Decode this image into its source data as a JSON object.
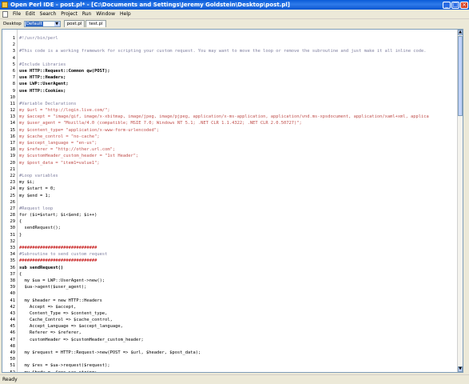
{
  "window": {
    "title": "Open Perl IDE - post.pl* - [C:\\Documents and Settings\\Jeremy Goldstein\\Desktop\\post.pl]"
  },
  "menu": [
    "File",
    "Edit",
    "Search",
    "Project",
    "Run",
    "Window",
    "Help"
  ],
  "toolbar": {
    "desktop_label": "Desktop",
    "desktop_value": "Default",
    "tabs": [
      "post.pl",
      "test.pl"
    ]
  },
  "status": {
    "text": "Ready"
  },
  "code": [
    {
      "n": "1",
      "t": "#!/usr/bin/perl",
      "c": "cmt"
    },
    {
      "n": "2",
      "t": "",
      "c": ""
    },
    {
      "n": "3",
      "t": "#This code is a working framework for scripting your custom request. You may want to move the loop or remove the subroutine and just make it all inline code.",
      "c": "cmt"
    },
    {
      "n": "4",
      "t": "",
      "c": ""
    },
    {
      "n": "5",
      "t": "#Include Libraries",
      "c": "cmt"
    },
    {
      "n": "6",
      "t": "use HTTP::Request::Common qw(POST);",
      "c": "kw"
    },
    {
      "n": "7",
      "t": "use HTTP::Headers;",
      "c": "kw"
    },
    {
      "n": "8",
      "t": "use LWP::UserAgent;",
      "c": "kw"
    },
    {
      "n": "9",
      "t": "use HTTP::Cookies;",
      "c": "kw"
    },
    {
      "n": "10",
      "t": "",
      "c": ""
    },
    {
      "n": "11",
      "t": "#Variable Declarations",
      "c": "cmt"
    },
    {
      "n": "12",
      "t": "my $url = \"http://login.live.com/\";",
      "c": "str"
    },
    {
      "n": "13",
      "t": "my $accept = \"image/gif, image/x-xbitmap, image/jpeg, image/pjpeg, application/x-ms-application, application/vnd.ms-xpsdocument, application/xaml+xml, applica",
      "c": "str"
    },
    {
      "n": "14",
      "t": "my $user_agent = \"Mozilla/4.0 (compatible; MSIE 7.0; Windows NT 5.1; .NET CLR 1.1.4322; .NET CLR 2.0.50727)\";",
      "c": "str"
    },
    {
      "n": "15",
      "t": "my $content_type= \"application/x-www-form-urlencoded\";",
      "c": "str"
    },
    {
      "n": "16",
      "t": "my $cache_control = \"no-cache\";",
      "c": "str"
    },
    {
      "n": "17",
      "t": "my $accept_language = \"en-us\";",
      "c": "str"
    },
    {
      "n": "18",
      "t": "my $referer = \"http://other.url.com\";",
      "c": "str"
    },
    {
      "n": "19",
      "t": "my $customHeader_custom_header = \"1st Header\";",
      "c": "str"
    },
    {
      "n": "20",
      "t": "my $post_data = \"item1=value1\";",
      "c": "str"
    },
    {
      "n": "21",
      "t": "",
      "c": ""
    },
    {
      "n": "22",
      "t": "#Loop variables",
      "c": "cmt"
    },
    {
      "n": "23",
      "t": "my $i;",
      "c": ""
    },
    {
      "n": "24",
      "t": "my $start = 0;",
      "c": ""
    },
    {
      "n": "25",
      "t": "my $end = 1;",
      "c": ""
    },
    {
      "n": "26",
      "t": "",
      "c": ""
    },
    {
      "n": "27",
      "t": "#Request loop",
      "c": "cmt"
    },
    {
      "n": "28",
      "t": "for ($i=$start; $i<$end; $i++)",
      "c": ""
    },
    {
      "n": "29",
      "t": "{",
      "c": ""
    },
    {
      "n": "30",
      "t": "  sendRequest();",
      "c": ""
    },
    {
      "n": "31",
      "t": "}",
      "c": ""
    },
    {
      "n": "32",
      "t": "",
      "c": ""
    },
    {
      "n": "33",
      "t": "##############################",
      "c": "red"
    },
    {
      "n": "34",
      "t": "#Subroutine to send custom request",
      "c": "cmt"
    },
    {
      "n": "35",
      "t": "##############################",
      "c": "red"
    },
    {
      "n": "36",
      "t": "sub sendRequest()",
      "c": "kw"
    },
    {
      "n": "37",
      "t": "{",
      "c": ""
    },
    {
      "n": "38",
      "t": "  my $ua = LWP::UserAgent->new();",
      "c": ""
    },
    {
      "n": "39",
      "t": "  $ua->agent($user_agent);",
      "c": ""
    },
    {
      "n": "40",
      "t": "",
      "c": ""
    },
    {
      "n": "41",
      "t": "  my $header = new HTTP::Headers",
      "c": ""
    },
    {
      "n": "42",
      "t": "    Accept => $accept,",
      "c": ""
    },
    {
      "n": "43",
      "t": "    Content_Type => $content_type,",
      "c": ""
    },
    {
      "n": "44",
      "t": "    Cache_Control => $cache_control,",
      "c": ""
    },
    {
      "n": "45",
      "t": "    Accept_Language => $accept_language,",
      "c": ""
    },
    {
      "n": "46",
      "t": "    Referer => $referer,",
      "c": ""
    },
    {
      "n": "47",
      "t": "    customHeader => $customHeader_custom_header;",
      "c": ""
    },
    {
      "n": "48",
      "t": "",
      "c": ""
    },
    {
      "n": "49",
      "t": "  my $request = HTTP::Request->new(POST => $url, $header, $post_data);",
      "c": ""
    },
    {
      "n": "50",
      "t": "",
      "c": ""
    },
    {
      "n": "51",
      "t": "  my $res = $ua->request($request);",
      "c": ""
    },
    {
      "n": "52",
      "t": "  my $body =  $res->as_string;",
      "c": ""
    },
    {
      "n": "53",
      "t": "",
      "c": ""
    },
    {
      "n": "54",
      "t": "  print ($res->as_string);",
      "c": ""
    },
    {
      "n": "55",
      "t": "}",
      "c": ""
    }
  ]
}
